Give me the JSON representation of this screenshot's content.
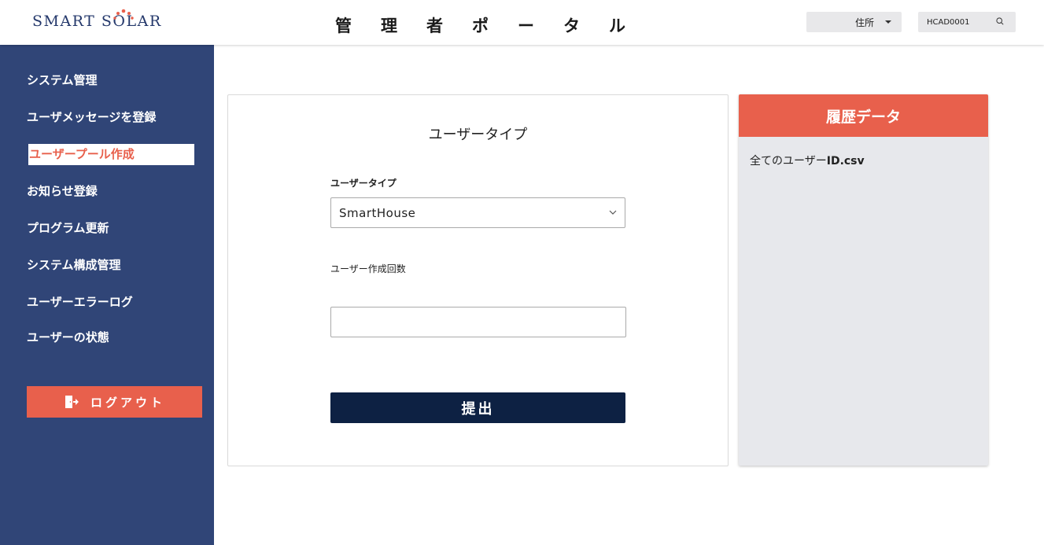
{
  "header": {
    "logo_text_a": "SMART S",
    "logo_text_o": "O",
    "logo_text_b": "LAR",
    "portal_title": "管理者ポータル",
    "address_select": "住所",
    "user_id": "HCAD0001"
  },
  "sidebar": {
    "items": [
      {
        "label": "システム管理"
      },
      {
        "label": "ユーザメッセージを登録"
      },
      {
        "label": "ユーザープール作成"
      },
      {
        "label": "お知らせ登録"
      },
      {
        "label": "プログラム更新"
      },
      {
        "label": "システム構成管理"
      },
      {
        "label": "ユーザーエラーログ"
      },
      {
        "label": "ユーザーの状態"
      }
    ],
    "active_index": 2,
    "logout_label": "ログアウト"
  },
  "form": {
    "title": "ユーザータイプ",
    "user_type_label": "ユーザータイプ",
    "user_type_value": "SmartHouse",
    "count_label": "ユーザー作成回数",
    "count_value": "",
    "submit_label": "提出"
  },
  "history": {
    "title": "履歴データ",
    "file_prefix": "全てのユーザー",
    "file_suffix": "ID.csv"
  },
  "colors": {
    "sidebar_bg": "#304577",
    "accent": "#e8604c",
    "submit_bg": "#0d2143",
    "history_bg": "#e7e8ec"
  }
}
